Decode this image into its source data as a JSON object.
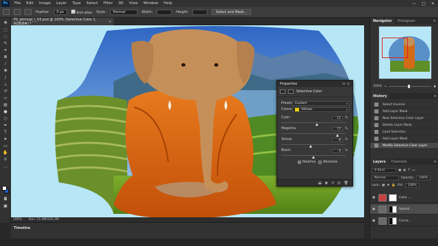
{
  "menu": {
    "logo": "Ps",
    "items": [
      "File",
      "Edit",
      "Image",
      "Layer",
      "Type",
      "Select",
      "Filter",
      "3D",
      "View",
      "Window",
      "Help"
    ],
    "win_controls": [
      "—",
      "□",
      "✕"
    ]
  },
  "options": {
    "feather_label": "Feather:",
    "feather_value": "0 px",
    "antialias_label": "Anti-alias",
    "style_label": "Style:",
    "style_value": "Normal",
    "width_label": "Width:",
    "height_label": "Height:",
    "select_mask_label": "Select and Mask..."
  },
  "document": {
    "tab_title": "PS_phmnpl_l_03.psd @ 100% (Selective Color 1, RGB/8#) *",
    "tab_close": "×",
    "zoom": "100%",
    "doc_info": "Doc: 11.4M/316.2M"
  },
  "timeline": {
    "label": "Timeline"
  },
  "properties": {
    "title": "Properties",
    "subtitle": "Selective Color",
    "preset_label": "Preset:",
    "preset_value": "Custom",
    "colors_label": "Colors:",
    "colors_value": "Yellows",
    "colors_swatch": "#f0d000",
    "sliders": [
      {
        "label": "Cyan:",
        "value": "11",
        "level": 0.56
      },
      {
        "label": "Magenta:",
        "value": "77",
        "level": 0.88
      },
      {
        "label": "Yellow:",
        "value": "-8",
        "level": 0.46
      },
      {
        "label": "Black:",
        "value": "0",
        "level": 0.5
      }
    ],
    "pct": "%",
    "relative_label": "Relative",
    "absolute_label": "Absolute"
  },
  "navigator": {
    "tab_active": "Navigator",
    "tab_other": "Histogram",
    "zoom": "100%"
  },
  "history": {
    "tab": "History",
    "items": [
      {
        "label": "Select Inverse",
        "active": false
      },
      {
        "label": "Add Layer Mask",
        "active": false
      },
      {
        "label": "New Selective Color Layer",
        "active": false
      },
      {
        "label": "Delete Layer Mask",
        "active": false
      },
      {
        "label": "Load Selection",
        "active": false
      },
      {
        "label": "Add Layer Mask",
        "active": false
      },
      {
        "label": "Modify Selective Color Layer",
        "active": true
      }
    ]
  },
  "layers": {
    "tab_active": "Layers",
    "tab_other": "Channels",
    "kind_label": "Kind",
    "blend_mode": "Normal",
    "opacity_label": "Opacity:",
    "opacity_value": "100%",
    "lock_label": "Lock:",
    "fill_label": "Fill:",
    "fill_value": "100%",
    "rows": [
      {
        "name": "Color ...",
        "thumb": "#c84040",
        "active": false
      },
      {
        "name": "Selecti...",
        "thumb": "#6a6a6a",
        "active": true
      },
      {
        "name": "Curve...",
        "thumb": "#6a6a6a",
        "active": false
      }
    ]
  }
}
